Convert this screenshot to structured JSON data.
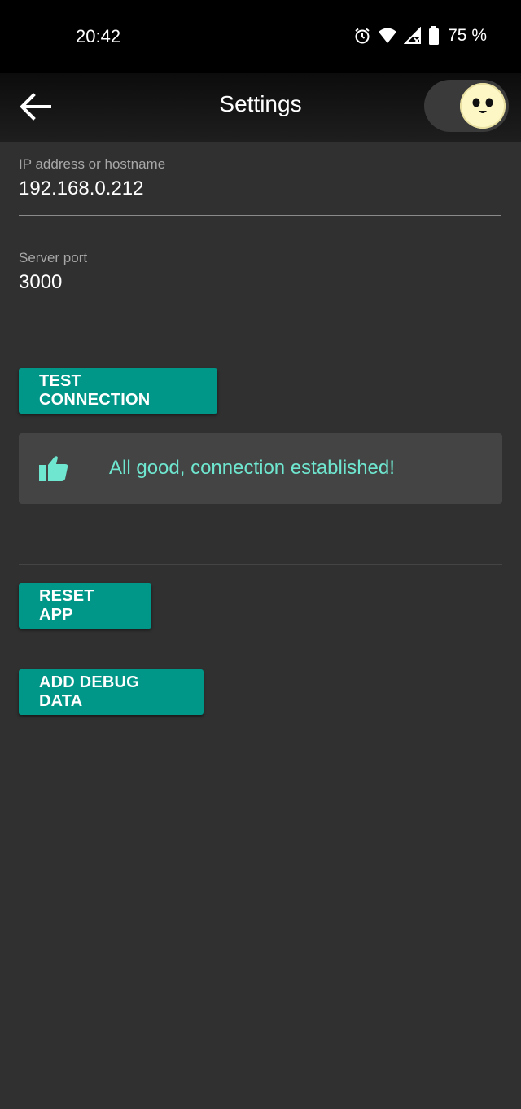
{
  "status_bar": {
    "time": "20:42",
    "battery_percent": "75 %",
    "icons": [
      "alarm-icon",
      "wifi-icon",
      "signal-icon",
      "battery-icon"
    ]
  },
  "app_bar": {
    "title": "Settings",
    "back_icon": "arrow-left-icon",
    "theme_toggle_on": true
  },
  "fields": {
    "host": {
      "label": "IP address or hostname",
      "value": "192.168.0.212"
    },
    "port": {
      "label": "Server port",
      "value": "3000"
    }
  },
  "buttons": {
    "test_connection": "TEST CONNECTION",
    "reset_app": "RESET APP",
    "add_debug_data": "ADD DEBUG DATA"
  },
  "connection_status": {
    "icon": "thumbs-up-icon",
    "message": "All good, connection established!"
  },
  "colors": {
    "background": "#303030",
    "accent": "#009688",
    "success_text": "#6fe6cf",
    "card": "#444444"
  }
}
